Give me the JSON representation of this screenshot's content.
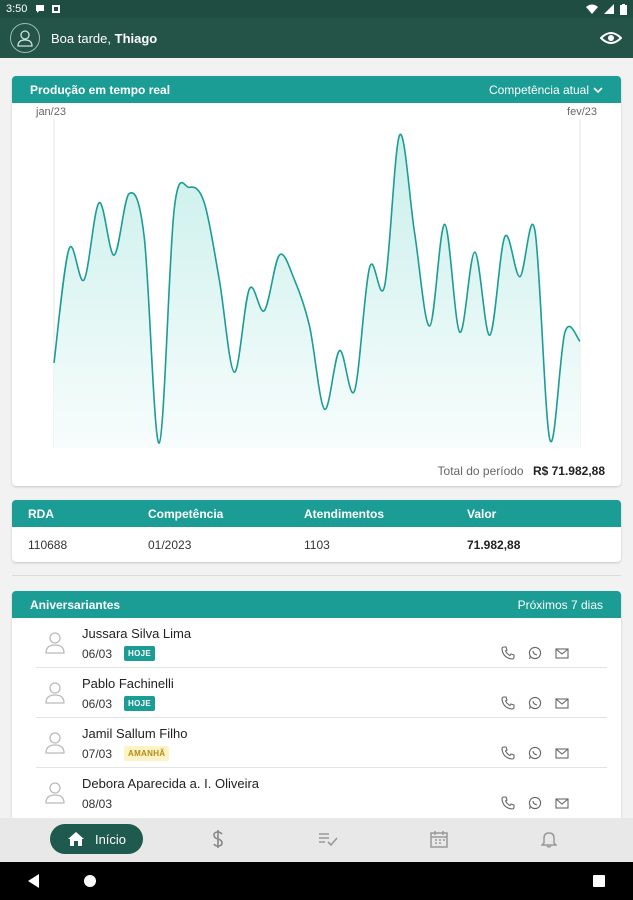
{
  "status_bar": {
    "time": "3:50"
  },
  "app_bar": {
    "greeting": "Boa tarde,",
    "user_name": "Thiago"
  },
  "production_card": {
    "title": "Produção em tempo real",
    "period_selector": "Competência atual",
    "x_start_label": "jan/23",
    "x_end_label": "fev/23",
    "total_label": "Total do período",
    "total_value": "R$ 71.982,88"
  },
  "chart_data": {
    "type": "area",
    "xlabel": "",
    "ylabel": "",
    "series": [
      {
        "values": [
          0.26,
          0.63,
          0.53,
          0.78,
          0.61,
          0.81,
          0.67,
          0.0,
          0.76,
          0.83,
          0.78,
          0.53,
          0.23,
          0.5,
          0.43,
          0.61,
          0.53,
          0.38,
          0.11,
          0.3,
          0.17,
          0.57,
          0.51,
          1.0,
          0.68,
          0.38,
          0.71,
          0.36,
          0.62,
          0.35,
          0.67,
          0.54,
          0.69,
          0.01,
          0.36,
          0.33
        ]
      }
    ],
    "colors": {
      "line": "#1b9c95",
      "fill_top": "#c9efeb",
      "fill_bottom": "#f4fcfb"
    }
  },
  "rda_table": {
    "headers": [
      "RDA",
      "Competência",
      "Atendimentos",
      "Valor"
    ],
    "row": [
      "110688",
      "01/2023",
      "1103",
      "71.982,88"
    ]
  },
  "birthdays_card": {
    "title": "Aniversariantes",
    "range": "Próximos 7 dias",
    "items": [
      {
        "name": "Jussara Silva Lima",
        "date": "06/03",
        "badge": "HOJE",
        "badge_type": "hoje"
      },
      {
        "name": "Pablo Fachinelli",
        "date": "06/03",
        "badge": "HOJE",
        "badge_type": "hoje"
      },
      {
        "name": "Jamil Sallum Filho",
        "date": "07/03",
        "badge": "AMANHÃ",
        "badge_type": "amanha"
      },
      {
        "name": "Debora Aparecida a. I. Oliveira",
        "date": "08/03",
        "badge": "",
        "badge_type": ""
      }
    ]
  },
  "bottom_nav": {
    "home_label": "Início",
    "items": [
      "home-icon",
      "dollar-icon",
      "checklist-icon",
      "calendar-icon",
      "bell-icon"
    ]
  },
  "colors": {
    "brand_dark": "#245447",
    "accent": "#1b9c95"
  }
}
